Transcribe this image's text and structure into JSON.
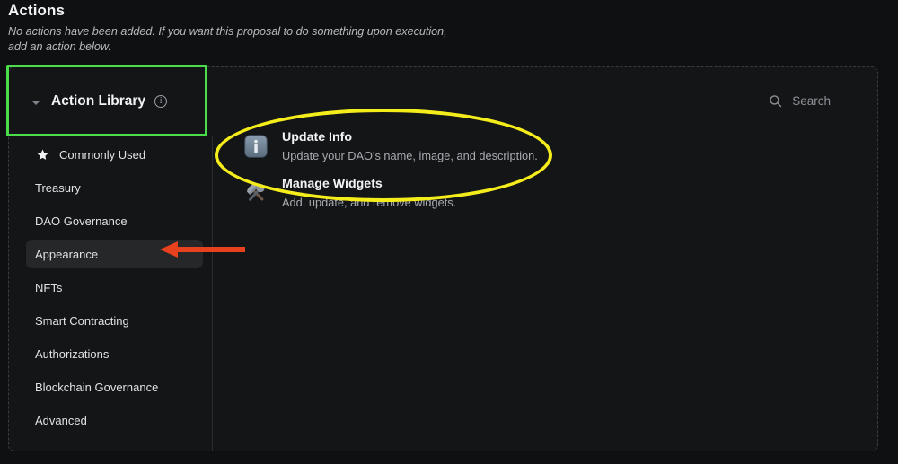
{
  "header": {
    "title": "Actions",
    "subtitle": "No actions have been added. If you want this proposal to do something upon execution, add an action below."
  },
  "library": {
    "title": "Action Library",
    "chevron_icon": "chevron-down-icon",
    "info_icon": "info-circle-icon",
    "collapsed": false
  },
  "sidebar": {
    "items": [
      {
        "label": "Commonly Used",
        "icon": "star-icon",
        "selected": false
      },
      {
        "label": "Treasury",
        "icon": "",
        "selected": false
      },
      {
        "label": "DAO Governance",
        "icon": "",
        "selected": false
      },
      {
        "label": "Appearance",
        "icon": "",
        "selected": true
      },
      {
        "label": "NFTs",
        "icon": "",
        "selected": false
      },
      {
        "label": "Smart Contracting",
        "icon": "",
        "selected": false
      },
      {
        "label": "Authorizations",
        "icon": "",
        "selected": false
      },
      {
        "label": "Blockchain Governance",
        "icon": "",
        "selected": false
      },
      {
        "label": "Advanced",
        "icon": "",
        "selected": false
      }
    ]
  },
  "search": {
    "icon": "search-icon",
    "placeholder": "Search",
    "value": ""
  },
  "actions": [
    {
      "icon": "information-emoji",
      "title": "Update Info",
      "description": "Update your DAO's name, image, and description."
    },
    {
      "icon": "hammer-and-wrench-emoji",
      "title": "Manage Widgets",
      "description": "Add, update, and remove widgets."
    }
  ],
  "annotations": {
    "green_box_color": "#4bdd4b",
    "yellow_ellipse_color": "#f5ed1b",
    "red_arrow_color": "#e8411e"
  },
  "colors": {
    "background": "#0f1011",
    "panel": "#141517",
    "selected_row": "#262728",
    "text_primary": "#f2f3f4",
    "text_secondary": "#a7acb1",
    "divider": "#2b2d30"
  }
}
